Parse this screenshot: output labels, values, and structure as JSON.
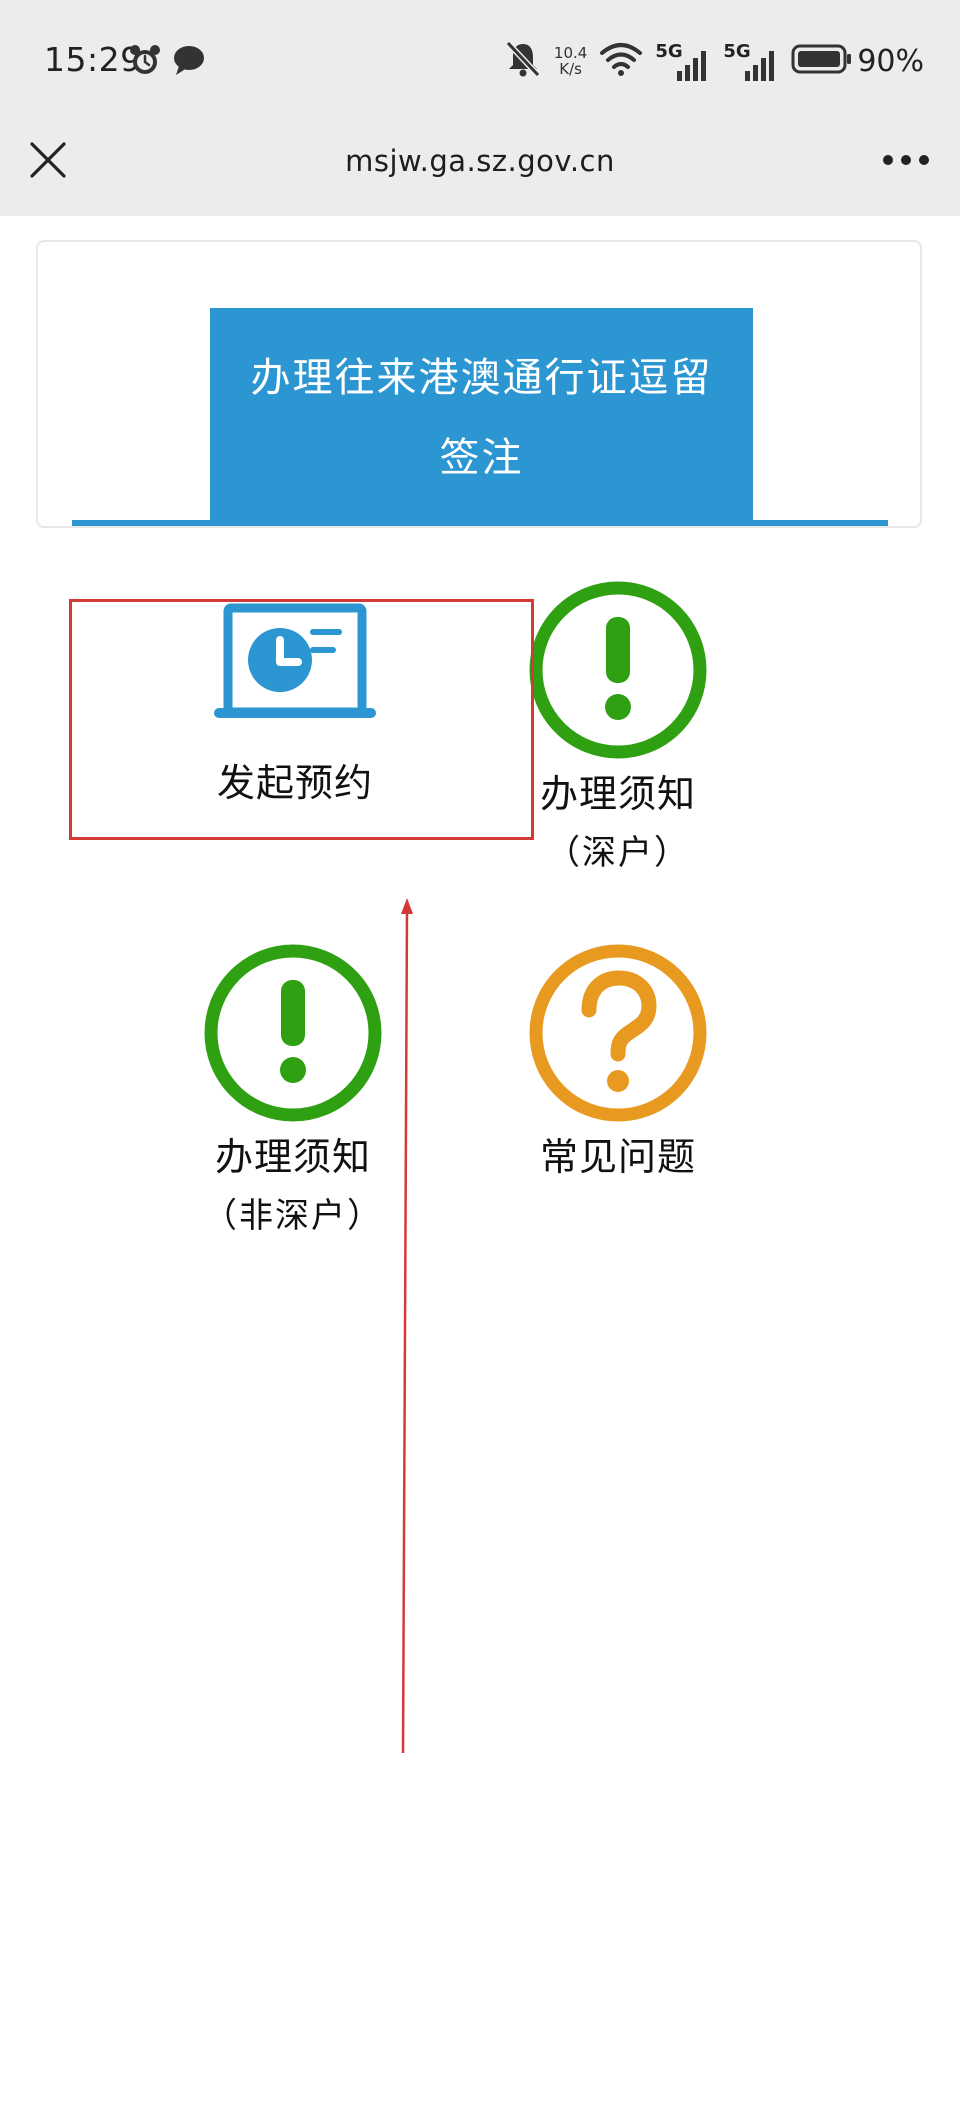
{
  "status_bar": {
    "time": "15:29",
    "left_icons": [
      "alarm-icon",
      "chat-bubble-icon"
    ],
    "net_speed_value": "10.4",
    "net_speed_unit": "K/s",
    "network_1": "5G",
    "network_2": "5G",
    "battery_percent": "90%"
  },
  "browser": {
    "url": "msjw.ga.sz.gov.cn",
    "close_icon": "close-icon",
    "more_icon": "more-dots-icon"
  },
  "page": {
    "title": "办理往来港澳通行证逗留签注",
    "accent_color": "#2b96d1"
  },
  "menu": [
    {
      "label": "发起预约",
      "sub": "",
      "icon": "appointment-clock-icon",
      "color": "#2b96d1"
    },
    {
      "label": "办理须知",
      "sub": "（深户）",
      "icon": "exclamation-circle-icon",
      "color": "#2ea012"
    },
    {
      "label": "办理须知",
      "sub": "（非深户）",
      "icon": "exclamation-circle-icon",
      "color": "#2ea012"
    },
    {
      "label": "常见问题",
      "sub": "",
      "icon": "question-circle-icon",
      "color": "#e79a1f"
    }
  ],
  "annotation": {
    "highlight_color": "#d33a36",
    "arrow_icon": "up-arrow-icon"
  }
}
